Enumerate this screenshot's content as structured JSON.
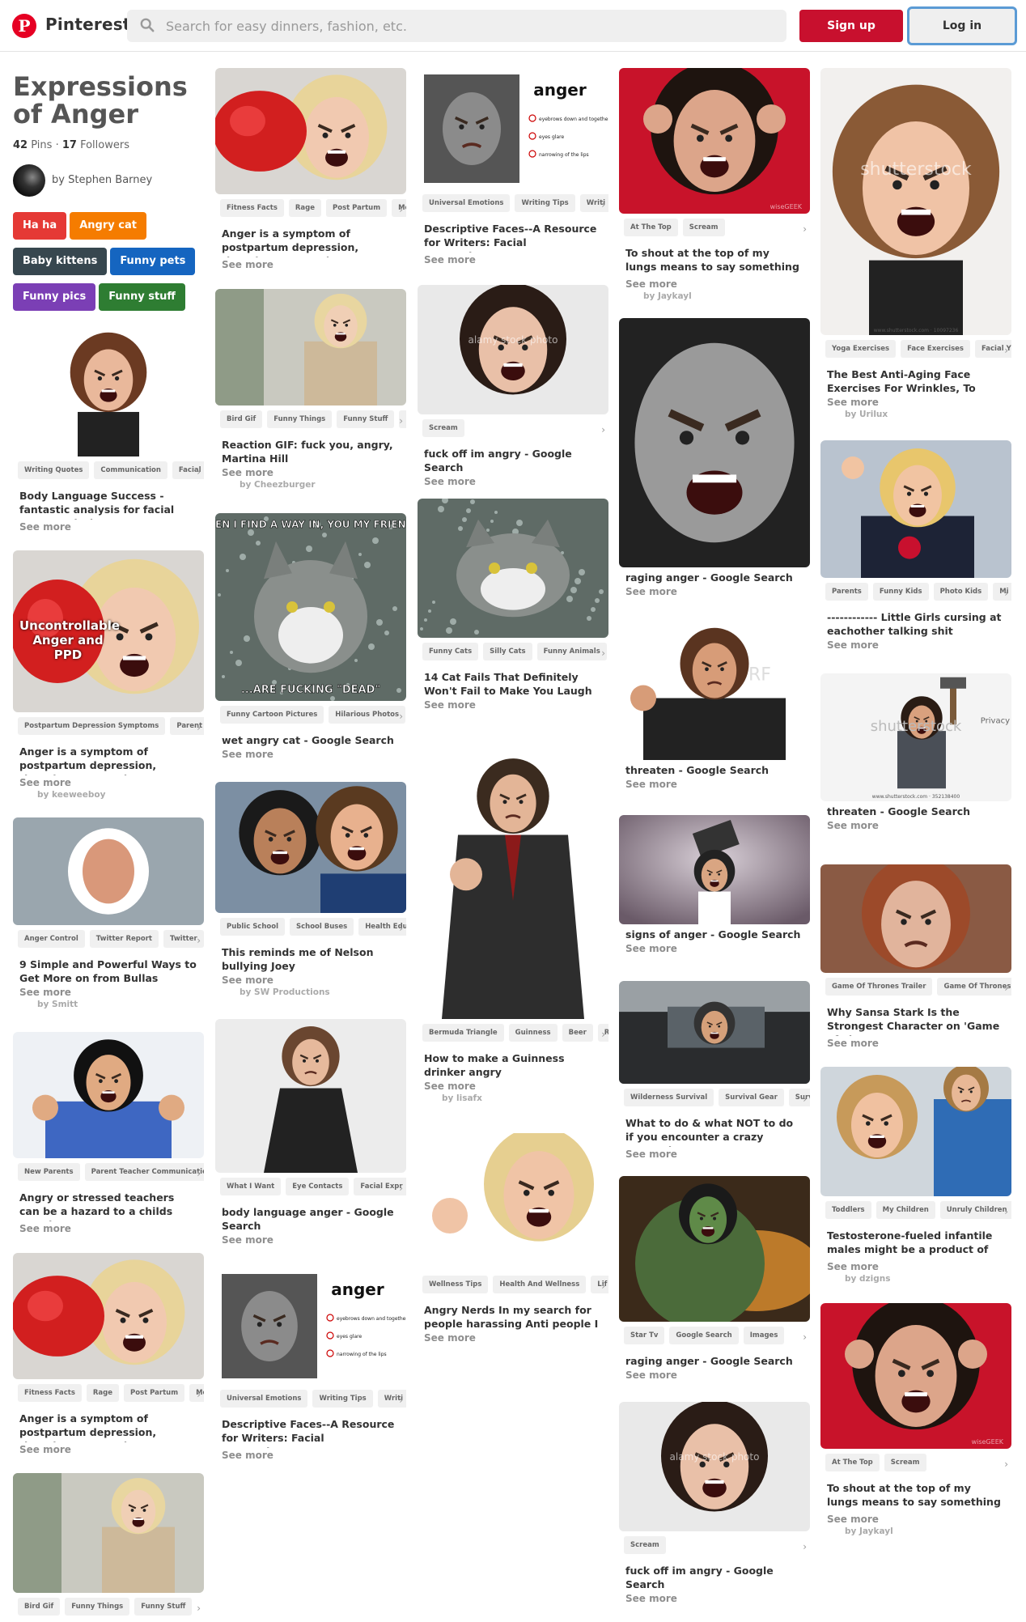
{
  "app": {
    "brand": "Pinterest",
    "search_placeholder": "Search for easy dinners, fashion, etc.",
    "signup": "Sign up",
    "login": "Log in"
  },
  "board": {
    "title": "Expressions of Anger",
    "pins": "42",
    "pins_label": "Pins",
    "sep": "·",
    "followers": "17",
    "followers_label": "Followers",
    "author_prefix": "by",
    "author": "Stephen Barney"
  },
  "tags": [
    {
      "label": "Ha ha",
      "color": "#e53935"
    },
    {
      "label": "Angry cat",
      "color": "#f57c00"
    },
    {
      "label": "Baby kittens",
      "color": "#37474f"
    },
    {
      "label": "Funny pets",
      "color": "#1565c0"
    },
    {
      "label": "Funny pics",
      "color": "#7b3fb5"
    },
    {
      "label": "Funny stuff",
      "color": "#2e7d32"
    }
  ],
  "icons": {
    "logo": "pinterest-logo-icon",
    "search": "search-icon",
    "chevron": "chevron-right-icon"
  },
  "watermarks": {
    "shutterstock": "shutterstock",
    "alamy": "alamy stock photo",
    "rf": "RF",
    "wisegeek": "wiseGEEK",
    "privacy": "Privacy"
  },
  "pins": [
    {
      "chips": [
        "Writing Quotes",
        "Communication",
        "Facial"
      ],
      "desc": "Body Language Success - fantastic analysis for facial nuances during",
      "more": "See more",
      "by": ""
    },
    {
      "chips": [
        "Postpartum Depression Symptoms",
        "Parent"
      ],
      "desc": "Anger is a symptom of postpartum depression, though most people",
      "more": "See more",
      "by": "by keeweeboy",
      "overlay": "Uncontrollable Anger and PPD"
    },
    {
      "chips": [
        "Anger Control",
        "Twitter Report",
        "Twitter"
      ],
      "desc": "9 Simple and Powerful Ways to Get More on from Bullas",
      "more": "See more",
      "by": "by Smitt"
    },
    {
      "chips": [
        "New Parents",
        "Parent Teacher Communication"
      ],
      "desc": "Angry or stressed teachers can be a hazard to a childs emotions.",
      "more": "See more",
      "by": ""
    },
    {
      "chips": [
        "Fitness Facts",
        "Rage",
        "Post Partum",
        "Me"
      ],
      "desc": "Anger is a symptom of postpartum depression, though most people",
      "more": "See more",
      "by": ""
    },
    {
      "chips": [
        "Bird Gif",
        "Funny Things",
        "Funny Stuff"
      ],
      "desc": "",
      "more": "",
      "by": ""
    },
    {
      "chips": [
        "Fitness Facts",
        "Rage",
        "Post Partum",
        "Me"
      ],
      "desc": "Anger is a symptom of postpartum depression, though most people",
      "more": "See more",
      "by": ""
    },
    {
      "chips": [
        "Bird Gif",
        "Funny Things",
        "Funny Stuff",
        "F"
      ],
      "desc": "Reaction GIF: fuck you, angry, Martina Hill",
      "more": "See more",
      "by": "by Cheezburger"
    },
    {
      "chips": [
        "Funny Cartoon Pictures",
        "Hilarious Photos"
      ],
      "desc": "wet angry cat - Google Search",
      "more": "See more",
      "by": "",
      "caption_top": "WHEN I FIND A WAY IN, YOU MY FRIEND...",
      "caption_bottom": "...ARE FUCKING \"DEAD\""
    },
    {
      "chips": [
        "Public School",
        "School Buses",
        "Health Edu"
      ],
      "desc": "This reminds me of Nelson bullying Joey",
      "more": "See more",
      "by": "by SW Productions"
    },
    {
      "chips": [
        "What I Want",
        "Eye Contacts",
        "Facial Expr"
      ],
      "desc": "body language anger - Google Search",
      "more": "See more",
      "by": ""
    },
    {
      "chips": [
        "Universal Emotions",
        "Writing Tips",
        "Writi"
      ],
      "desc": "Descriptive Faces--A Resource for Writers: Facial Expressions--Anger",
      "more": "See more",
      "by": "",
      "word": "anger",
      "notes": [
        "eyebrows down and together",
        "eyes glare",
        "narrowing of the lips"
      ]
    },
    {
      "chips": [
        "Universal Emotions",
        "Writing Tips",
        "Writi"
      ],
      "desc": "Descriptive Faces--A Resource for Writers: Facial Expressions--Anger",
      "more": "See more",
      "by": "",
      "word": "anger",
      "notes": [
        "eyebrows down and together",
        "eyes glare",
        "narrowing of the lips"
      ]
    },
    {
      "chips": [
        "Scream"
      ],
      "desc": "fuck off im angry - Google Search",
      "more": "See more",
      "by": ""
    },
    {
      "chips": [
        "Funny Cats",
        "Silly Cats",
        "Funny Animals"
      ],
      "desc": "14 Cat Fails That Definitely Won't Fail to Make You Laugh",
      "more": "See more",
      "by": ""
    },
    {
      "chips": [
        "Bermuda Triangle",
        "Guinness",
        "Beer",
        "R"
      ],
      "desc": "How to make a Guinness drinker angry",
      "more": "See more",
      "by": "by lisafx"
    },
    {
      "chips": [
        "Wellness Tips",
        "Health And Wellness",
        "Lif"
      ],
      "desc": "Angry Nerds In my search for people harassing Anti people I",
      "more": "See more",
      "by": ""
    },
    {
      "chips": [
        "At The Top",
        "Scream"
      ],
      "desc": "To shout at the top of my lungs means to say something very",
      "more": "See more",
      "by": "by Jaykayl"
    },
    {
      "chips": [],
      "desc": "raging anger - Google Search",
      "more": "See more",
      "by": ""
    },
    {
      "chips": [],
      "desc": "threaten - Google Search",
      "more": "See more",
      "by": ""
    },
    {
      "chips": [],
      "desc": "signs of anger - Google Search",
      "more": "See more",
      "by": ""
    },
    {
      "chips": [
        "Wilderness Survival",
        "Survival Gear",
        "Surv"
      ],
      "desc": "What to do & what NOT to do if you encounter a crazy person in a",
      "more": "See more",
      "by": ""
    },
    {
      "chips": [
        "Star Tv",
        "Google Search",
        "Images"
      ],
      "desc": "raging anger - Google Search",
      "more": "See more",
      "by": ""
    },
    {
      "chips": [
        "Scream"
      ],
      "desc": "fuck off im angry - Google Search",
      "more": "See more",
      "by": ""
    },
    {
      "chips": [
        "Yoga Exercises",
        "Face Exercises",
        "Facial Y"
      ],
      "desc": "The Best Anti-Aging Face Exercises For Wrinkles, To",
      "more": "See more",
      "by": "by Urilux",
      "caption": "www.shutterstock.com · 10097236"
    },
    {
      "chips": [
        "Parents",
        "Funny Kids",
        "Photo Kids",
        "Mi"
      ],
      "desc": "------------ Little Girls cursing at eachother talking shit",
      "more": "See more",
      "by": ""
    },
    {
      "chips": [],
      "desc": "threaten - Google Search",
      "more": "See more",
      "by": "",
      "caption": "www.shutterstock.com · 352138400"
    },
    {
      "chips": [
        "Game Of Thrones Trailer",
        "Game Of Thrones"
      ],
      "desc": "Why Sansa Stark Is the Strongest Character on 'Game of Thrones' -",
      "more": "See more",
      "by": ""
    },
    {
      "chips": [
        "Toddlers",
        "My Children",
        "Unruly Children"
      ],
      "desc": "Testosterone-fueled infantile males might be a product of Mom's",
      "more": "See more",
      "by": "by dzigns"
    },
    {
      "chips": [
        "At The Top",
        "Scream"
      ],
      "desc": "To shout at the top of my lungs means to say something very",
      "more": "See more",
      "by": "by Jaykayl"
    }
  ]
}
